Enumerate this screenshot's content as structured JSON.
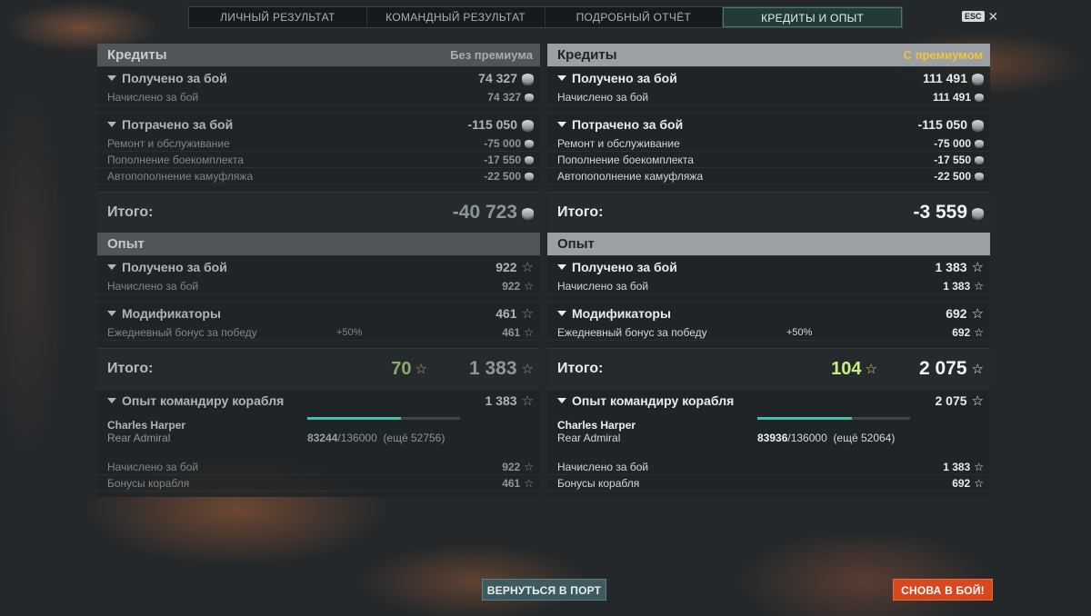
{
  "tabs": [
    "ЛИЧНЫЙ РЕЗУЛЬТАТ",
    "КОМАНДНЫЙ РЕЗУЛЬТАТ",
    "ПОДРОБНЫЙ ОТЧЁТ",
    "КРЕДИТЫ И ОПЫТ"
  ],
  "active_tab": "КРЕДИТЫ И ОПЫТ",
  "esc_label": "ESC",
  "close_glyph": "✕",
  "colors": {
    "premium_tag": "#f3c437",
    "active_tab": "#243a37",
    "battle_button": "#d8481f",
    "port_button": "#3d5a5f",
    "progress": "#43c0ad"
  },
  "left": {
    "credits_title": "Кредиты",
    "credits_tag": "Без премиума",
    "earned_label": "Получено за бой",
    "earned_value": "74 327",
    "earned_row_label": "Начислено за бой",
    "earned_row_value": "74 327",
    "spent_label": "Потрачено за бой",
    "spent_value": "-115 050",
    "repair_label": "Ремонт и обслуживание",
    "repair_value": "-75 000",
    "ammo_label": "Пополнение боекомплекта",
    "ammo_value": "-17 550",
    "camo_label": "Автопополнение камуфляжа",
    "camo_value": "-22 500",
    "credits_total_label": "Итого:",
    "credits_total_value": "-40 723",
    "exp_title": "Опыт",
    "exp_earned_label": "Получено за бой",
    "exp_earned_value": "922",
    "exp_earned_row_label": "Начислено за бой",
    "exp_earned_row_value": "922",
    "mod_label": "Модификаторы",
    "mod_value": "461",
    "bonus_label": "Ежедневный бонус за победу",
    "bonus_percent": "+50%",
    "bonus_value": "461",
    "exp_total_label": "Итого:",
    "exp_total_free": "70",
    "exp_total_value": "1 383",
    "cmd_label": "Опыт командиру корабля",
    "cmd_value": "1 383",
    "cmd_name": "Charles Harper",
    "cmd_rank": "Rear Admiral",
    "cmd_current": "83244",
    "cmd_max": "/136000",
    "cmd_remaining": "(ещё 52756)",
    "cmd_progress": 0.612,
    "cmd_battle_label": "Начислено за бой",
    "cmd_battle_value": "922",
    "cmd_ship_label": "Бонусы корабля",
    "cmd_ship_value": "461"
  },
  "right": {
    "credits_title": "Кредиты",
    "credits_tag": "С премиумом",
    "earned_label": "Получено за бой",
    "earned_value": "111 491",
    "earned_row_label": "Начислено за бой",
    "earned_row_value": "111 491",
    "spent_label": "Потрачено за бой",
    "spent_value": "-115 050",
    "repair_label": "Ремонт и обслуживание",
    "repair_value": "-75 000",
    "ammo_label": "Пополнение боекомплекта",
    "ammo_value": "-17 550",
    "camo_label": "Автопополнение камуфляжа",
    "camo_value": "-22 500",
    "credits_total_label": "Итого:",
    "credits_total_value": "-3 559",
    "exp_title": "Опыт",
    "exp_earned_label": "Получено за бой",
    "exp_earned_value": "1 383",
    "exp_earned_row_label": "Начислено за бой",
    "exp_earned_row_value": "1 383",
    "mod_label": "Модификаторы",
    "mod_value": "692",
    "bonus_label": "Ежедневный бонус за победу",
    "bonus_percent": "+50%",
    "bonus_value": "692",
    "exp_total_label": "Итого:",
    "exp_total_free": "104",
    "exp_total_value": "2 075",
    "cmd_label": "Опыт командиру корабля",
    "cmd_value": "2 075",
    "cmd_name": "Charles Harper",
    "cmd_rank": "Rear Admiral",
    "cmd_current": "83936",
    "cmd_max": "/136000",
    "cmd_remaining": "(ещё 52064)",
    "cmd_progress": 0.617,
    "cmd_battle_label": "Начислено за бой",
    "cmd_battle_value": "1 383",
    "cmd_ship_label": "Бонусы корабля",
    "cmd_ship_value": "692"
  },
  "buttons": {
    "port": "ВЕРНУТЬСЯ В ПОРТ",
    "battle": "СНОВА В БОЙ!"
  }
}
